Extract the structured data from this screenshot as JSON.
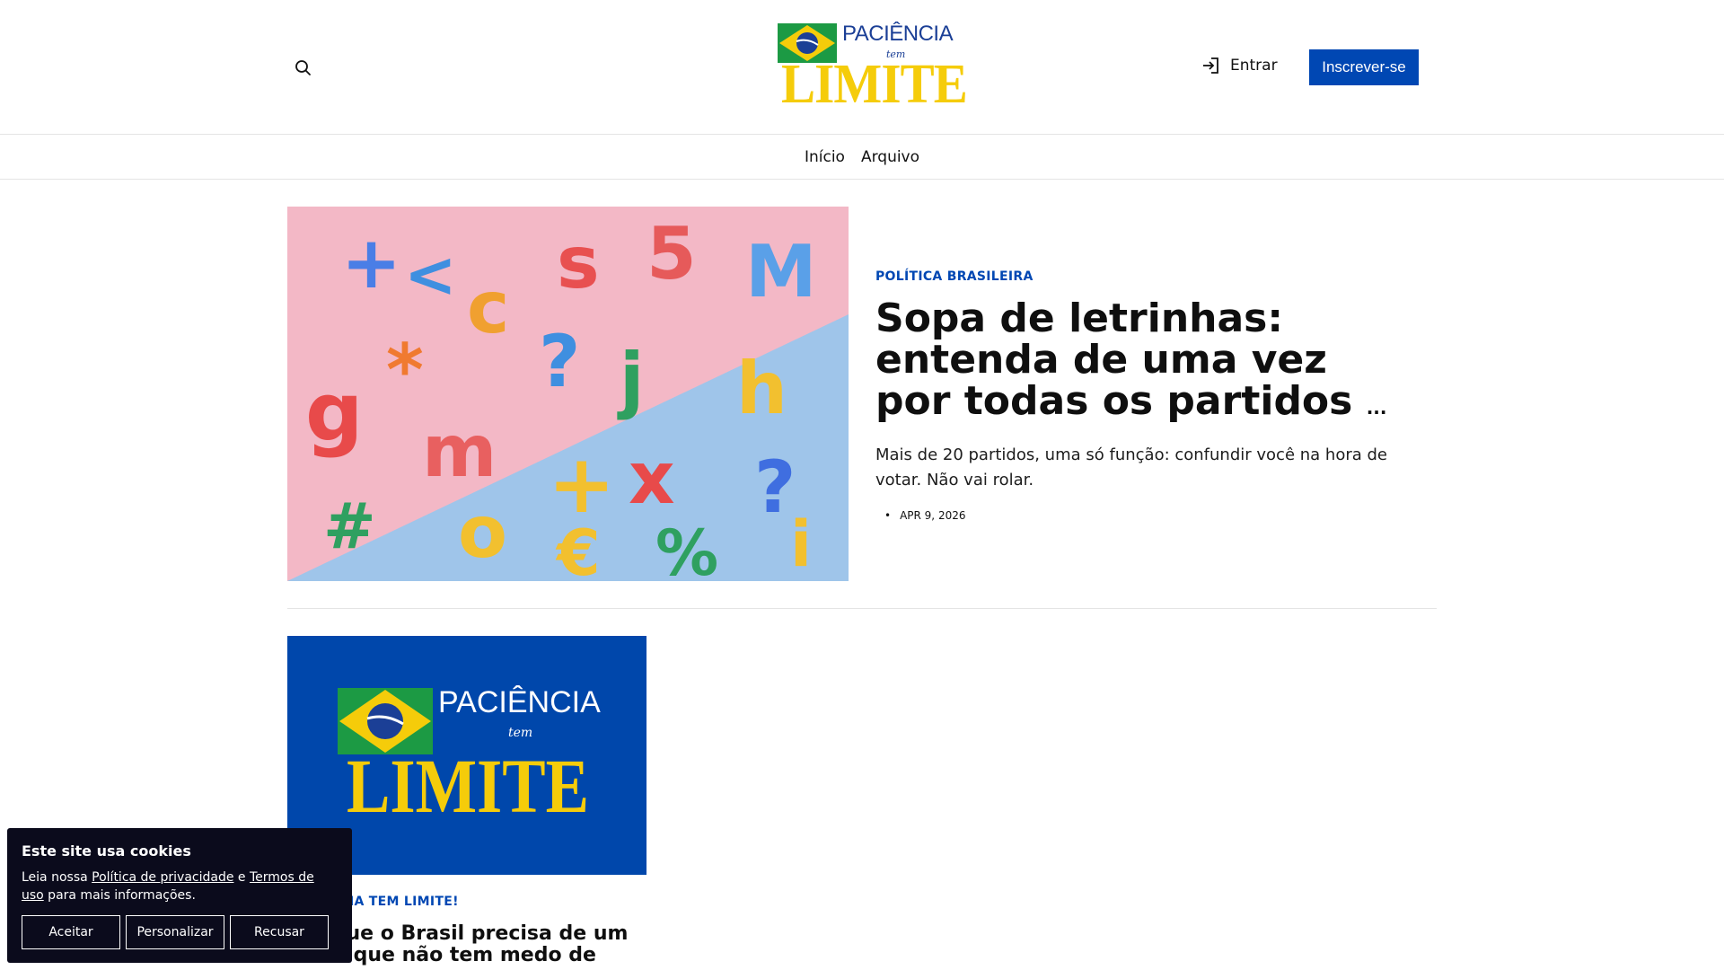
{
  "header": {
    "logo": {
      "top": "PACIÊNCIA",
      "mid": "tem",
      "bottom": "LIMITE"
    },
    "signin_label": "Entrar",
    "subscribe_label": "Inscrever-se",
    "icons": {
      "search": "search-icon",
      "signin": "signin-icon"
    }
  },
  "nav": {
    "items": [
      "Início",
      "Arquivo"
    ]
  },
  "feature": {
    "tag": "POLÍTICA BRASILEIRA",
    "title": "Sopa de letrinhas: entenda de uma vez por todas os partidos",
    "title_ellipsis": "...",
    "excerpt": "Mais de 20 partidos, uma só função: confundir você na hora de votar. Não vai rolar.",
    "bullet": "•",
    "date": "APR 9, 2026"
  },
  "card": {
    "logo": {
      "top": "PACIÊNCIA",
      "mid": "tem",
      "bottom": "LIMITE"
    },
    "tag": "PACIÊNCIA TEM LIMITE!",
    "title": "Por que o Brasil precisa de um canal que não tem medo de"
  },
  "cookie": {
    "title": "Este site usa cookies",
    "text_1": "Leia nossa ",
    "privacy_link": "Política de privacidade",
    "text_2": " e ",
    "terms_link": "Termos de uso",
    "text_3": " para mais informações.",
    "accept": "Aceitar",
    "customize": "Personalizar",
    "reject": "Recusar"
  },
  "colors": {
    "brand_blue": "#0047b3",
    "brand_yellow": "#f5cc0a",
    "brand_green": "#1c9a44",
    "cookie_bg": "#0b0b1c"
  }
}
